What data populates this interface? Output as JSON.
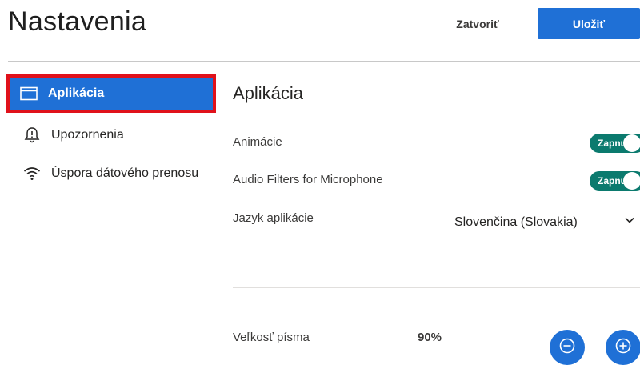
{
  "header": {
    "title": "Nastavenia",
    "close_label": "Zatvoriť",
    "save_label": "Uložiť"
  },
  "sidebar": {
    "items": [
      {
        "label": "Aplikácia",
        "icon": "window-icon",
        "active": true
      },
      {
        "label": "Upozornenia",
        "icon": "bell-alert-icon",
        "active": false
      },
      {
        "label": "Úspora dátového prenosu",
        "icon": "wifi-icon",
        "active": false
      }
    ]
  },
  "main": {
    "section_title": "Aplikácia",
    "settings": [
      {
        "label": "Animácie",
        "toggle_text": "Zapnuté",
        "on": true
      },
      {
        "label": "Audio Filters for Microphone",
        "toggle_text": "Zapnuté",
        "on": true
      }
    ],
    "language": {
      "label": "Jazyk aplikácie",
      "selected": "Slovenčina (Slovakia)"
    },
    "font_size": {
      "label": "Veľkosť písma",
      "value": "90%",
      "decrease_icon": "minus-circle-icon",
      "increase_icon": "plus-circle-icon"
    }
  },
  "colors": {
    "accent": "#1f70d6",
    "toggle_on": "#0b7a6e",
    "highlight_outline": "#e0111b"
  }
}
